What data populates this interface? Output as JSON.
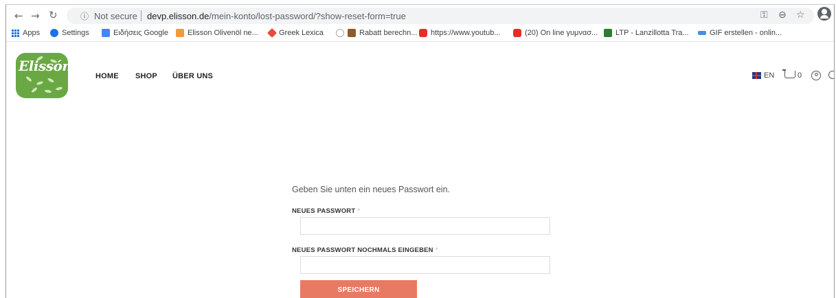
{
  "browser": {
    "security": "Not secure",
    "url_host": "devp.elisson.de",
    "url_path": "/mein-konto/lost-password/?show-reset-form=true",
    "nav_icons": [
      "back-icon",
      "forward-icon",
      "reload-icon"
    ],
    "right_icons": [
      "key-icon",
      "zoom-icon",
      "star-icon",
      "profile-icon"
    ]
  },
  "bookmarks": [
    {
      "label": "Apps",
      "icon": "apps-icon",
      "color": "#1a73e8"
    },
    {
      "label": "Settings",
      "icon": "gear-icon",
      "color": "#1a73e8"
    },
    {
      "label": "Ειδήσεις Google",
      "icon": "news-icon",
      "color": "#4285f4"
    },
    {
      "label": "Elisson Olivenöl ne...",
      "icon": "elisson-icon",
      "color": "#f29a38"
    },
    {
      "label": "Greek Lexica",
      "icon": "lexica-icon",
      "color": "#e74c3c"
    },
    {
      "label": "Rabatt berechn...",
      "icon": "rabatt-icon",
      "color": "#8e5a2b"
    },
    {
      "label": "https://www.youtub...",
      "icon": "youtube-icon",
      "color": "#e52d27"
    },
    {
      "label": "(20) On line γυμνασ...",
      "icon": "youtube-icon",
      "color": "#e52d27"
    },
    {
      "label": "LTP - Lanzillotta Tra...",
      "icon": "ltp-icon",
      "color": "#2e7d32"
    },
    {
      "label": "GIF erstellen - onlin...",
      "icon": "gif-icon",
      "color": "#4a90d9"
    }
  ],
  "site": {
    "logo_text": "Elissón",
    "nav": [
      "HOME",
      "SHOP",
      "ÜBER UNS"
    ],
    "language": "EN",
    "cart_count": "0",
    "accent": "#e87a63",
    "logo_color": "#6aa844"
  },
  "form": {
    "intro": "Geben Sie unten ein neues Passwort ein.",
    "field1_label": "NEUES PASSWORT",
    "field2_label": "NEUES PASSWORT NOCHMALS EINGEBEN",
    "required_mark": "*",
    "field1_value": "",
    "field2_value": "",
    "submit_label": "SPEICHERN"
  }
}
